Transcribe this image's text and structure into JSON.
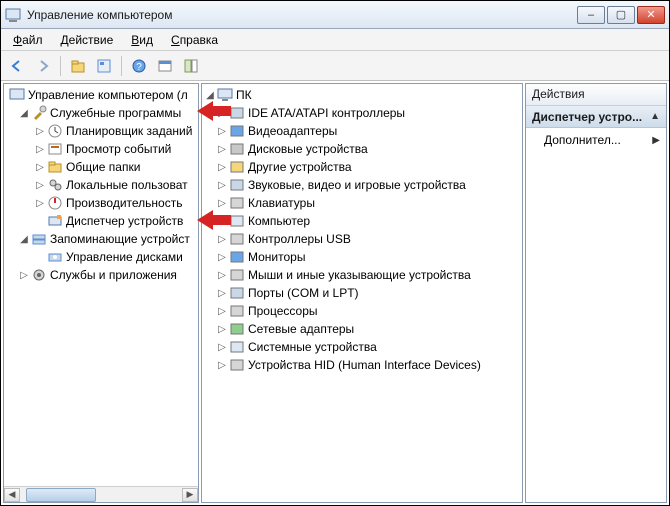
{
  "window": {
    "title": "Управление компьютером"
  },
  "menu": {
    "file": {
      "label": "Файл",
      "underline": "Ф"
    },
    "action": {
      "label": "Действие",
      "underline": "Д"
    },
    "view": {
      "label": "Вид",
      "underline": "В"
    },
    "help": {
      "label": "Справка",
      "underline": "С"
    }
  },
  "toolbar": {
    "back": "Назад",
    "forward": "Вперёд",
    "up": "Вверх",
    "props": "Свойства",
    "help": "Справка",
    "refresh": "Обновить",
    "show": "Показать"
  },
  "left_tree": {
    "root": "Управление компьютером (л",
    "tools": "Служебные программы",
    "tools_children": [
      "Планировщик заданий",
      "Просмотр событий",
      "Общие папки",
      "Локальные пользоват",
      "Производительность",
      "Диспетчер устройств"
    ],
    "storage": "Запоминающие устройст",
    "storage_children": [
      "Управление дисками"
    ],
    "services": "Службы и приложения"
  },
  "mid_tree": {
    "root": "ПК",
    "items": [
      "IDE ATA/ATAPI контроллеры",
      "Видеоадаптеры",
      "Дисковые устройства",
      "Другие устройства",
      "Звуковые, видео и игровые устройства",
      "Клавиатуры",
      "Компьютер",
      "Контроллеры USB",
      "Мониторы",
      "Мыши и иные указывающие устройства",
      "Порты (COM и LPT)",
      "Процессоры",
      "Сетевые адаптеры",
      "Системные устройства",
      "Устройства HID (Human Interface Devices)"
    ]
  },
  "actions": {
    "header": "Действия",
    "group": "Диспетчер устро...",
    "more": "Дополнител..."
  }
}
